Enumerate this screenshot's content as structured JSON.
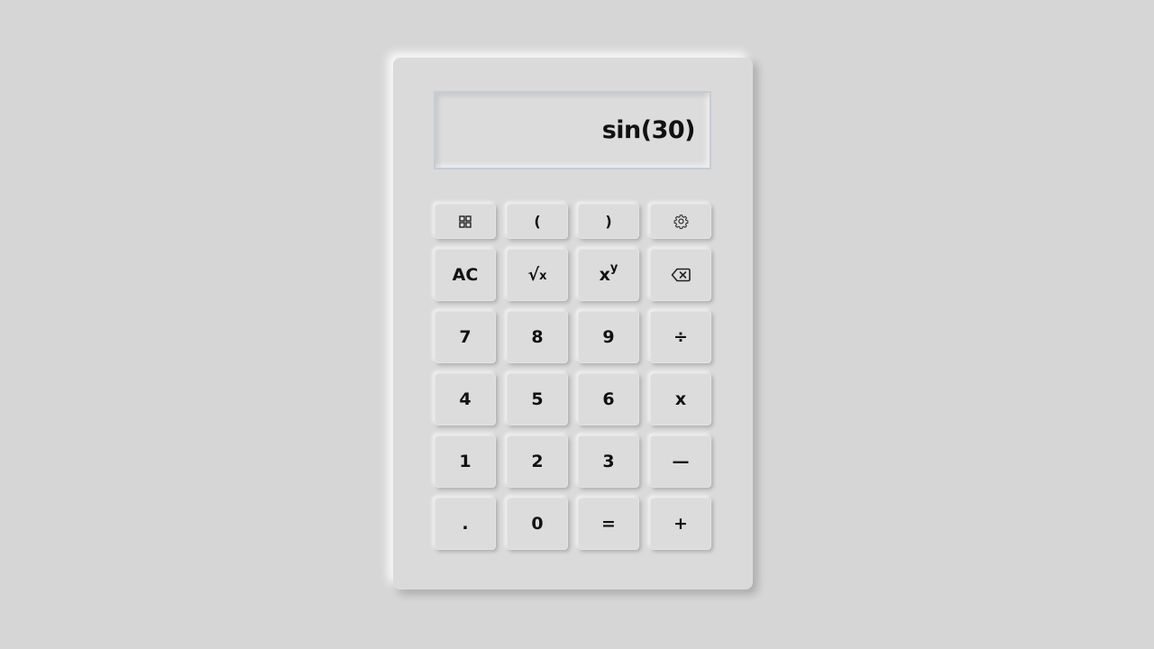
{
  "display": {
    "expression": "sin(30)"
  },
  "buttons": {
    "menu_icon": "grid-icon",
    "open_paren": "(",
    "close_paren": ")",
    "settings_icon": "gear-icon",
    "clear": "AC",
    "sqrt_radical": "√",
    "sqrt_var": "x",
    "power_base": "x",
    "power_exp": "y",
    "backspace_icon": "backspace-icon",
    "seven": "7",
    "eight": "8",
    "nine": "9",
    "divide": "÷",
    "four": "4",
    "five": "5",
    "six": "6",
    "multiply": "x",
    "one": "1",
    "two": "2",
    "three": "3",
    "minus": "—",
    "decimal": ".",
    "zero": "0",
    "equals": "=",
    "plus": "+"
  }
}
